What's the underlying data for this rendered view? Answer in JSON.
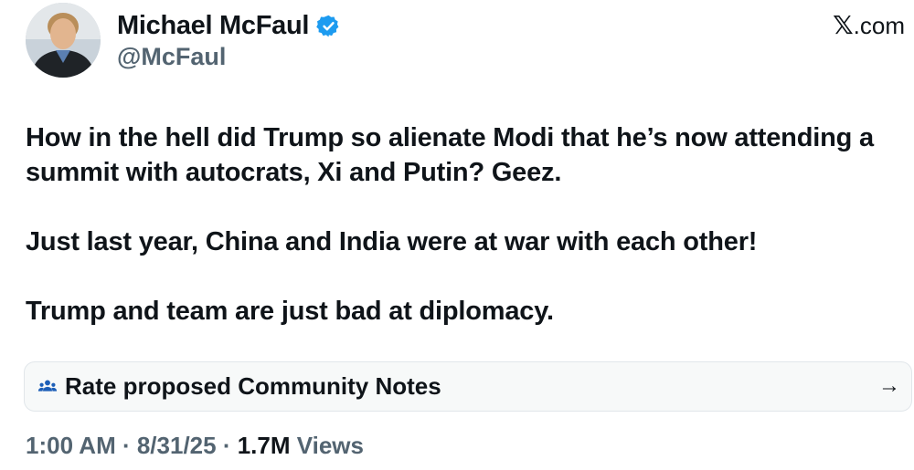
{
  "brand": {
    "x_letter": "𝕏",
    "suffix": ".com"
  },
  "author": {
    "display_name": "Michael McFaul",
    "handle": "@McFaul",
    "verified": true
  },
  "tweet": {
    "paragraphs": [
      "How in the hell did Trump so alienate Modi that he’s now attending a summit with autocrats, Xi and Putin? Geez.",
      "Just last year, China and India were at war with each other!",
      "Trump and team are just bad at diplomacy."
    ]
  },
  "community_notes": {
    "label": "Rate proposed Community Notes",
    "arrow": "→"
  },
  "meta": {
    "time": "1:00 AM",
    "separator": " · ",
    "date": "8/31/25",
    "views_count": "1.7M",
    "views_label": " Views"
  },
  "colors": {
    "text_primary": "#0f1419",
    "text_secondary": "#536471",
    "verified_blue": "#1d9bf0",
    "notes_background": "#f7f9f9"
  }
}
